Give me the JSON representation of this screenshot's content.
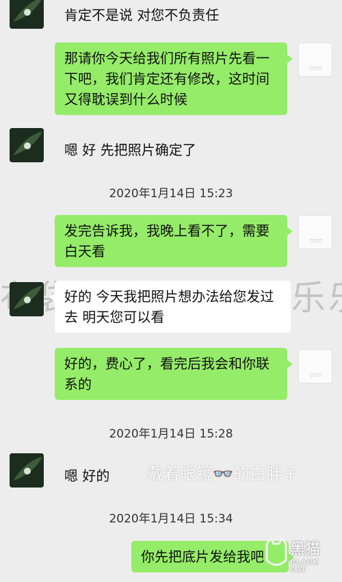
{
  "messages": [
    {
      "side": "left",
      "text": "肯定不是说 对您不负责任"
    },
    {
      "side": "right",
      "text": "那请你今天给我们所有照片先看一下吧，我们肯定还有修改，这时间又得耽误到什么时候"
    },
    {
      "side": "left",
      "text": "嗯 好 先把照片确定了"
    },
    {
      "side": "right",
      "text": "发完告诉我，我晚上看不了，需要白天看"
    },
    {
      "side": "left",
      "text": "好的 今天我把照片想办法给您发过去 明天您可以看"
    },
    {
      "side": "right",
      "text": "好的，费心了，看完后我会和你联系的"
    },
    {
      "side": "left",
      "text": "嗯 好的"
    },
    {
      "side": "right",
      "text": "你先把底片发给我吧"
    }
  ],
  "timestamps": [
    "2020年1月14日 15:23",
    "2020年1月14日 15:28",
    "2020年1月14日 15:34"
  ],
  "avatar_right_caption": "♡♡♡",
  "watermarks": {
    "band": "布袋摇滚熊乐园◎乐乐场",
    "author": "戴着眼镜👓的白胖子",
    "logo_cn": "黑猫",
    "logo_en": "BLACK CAT"
  },
  "colors": {
    "background": "#ededed",
    "bubble_left": "#ffffff",
    "bubble_right": "#95ec69"
  }
}
